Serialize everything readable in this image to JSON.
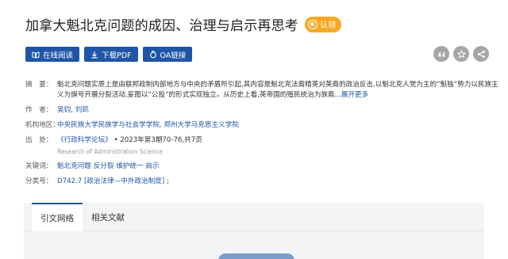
{
  "title": "加拿大魁北克问题的成因、治理与启示再思考",
  "claim_label": "认领",
  "actions": [
    {
      "label": "在线阅读",
      "icon": "book-icon"
    },
    {
      "label": "下载PDF",
      "icon": "download-icon"
    },
    {
      "label": "OA链接",
      "icon": "oa-icon"
    }
  ],
  "tools": [
    {
      "icon": "quote-icon"
    },
    {
      "icon": "star-icon"
    },
    {
      "icon": "share-icon"
    }
  ],
  "meta": {
    "abstract_label": "摘　要：",
    "abstract_text": "魁北克问题实质上是由联邦政制内部地方与中央的矛盾所引起,其内容是魁北克法裔精英对英裔的政治反击,以魁北克人党为主的“魁独”势力以民族主义为旗号开展分裂活动,妄图以“公投”的形式实现独立。从历史上看,英帝国的殖民统治为族裔...",
    "abstract_more": "展开更多",
    "author_label": "作　者：",
    "authors": "吴钧, 刘凯",
    "org_label": "机构地区：",
    "org": "中央民族大学民族学与社会学学院, 郑州大学马克思主义学院",
    "source_label": "出　处：",
    "source_journal": "《行政科学论坛》",
    "source_dot": "•",
    "source_issue": "2023年第3期70-76,共7页",
    "source_en": "Research of Administration Science",
    "keywords_label": "关键词：",
    "keywords": "魁北克问题  反分裂  维护统一  启示",
    "class_label": "分类号：",
    "class_code": "D742.7 [政治法律—中外政治制度]",
    "class_sep": ";"
  },
  "tabs": [
    {
      "label": "引文网络",
      "active": true
    },
    {
      "label": "相关文献",
      "active": false
    }
  ],
  "colors": {
    "accent": "#1f55a6",
    "claim": "#f7a823",
    "tool_bg": "#a6a6a6"
  }
}
